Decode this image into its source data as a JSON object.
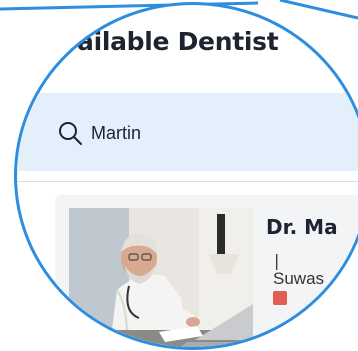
{
  "page": {
    "title": "ailable Dentist"
  },
  "search": {
    "value": "Martin",
    "icon": "search-icon"
  },
  "results": [
    {
      "name": "Dr. Ma",
      "separator": "|",
      "location": "Suwas",
      "badge_color": "#e05d4f"
    }
  ],
  "colors": {
    "accent": "#2f8de0",
    "search_bg": "#e3f0fb",
    "card_bg": "#f3f4f6"
  }
}
